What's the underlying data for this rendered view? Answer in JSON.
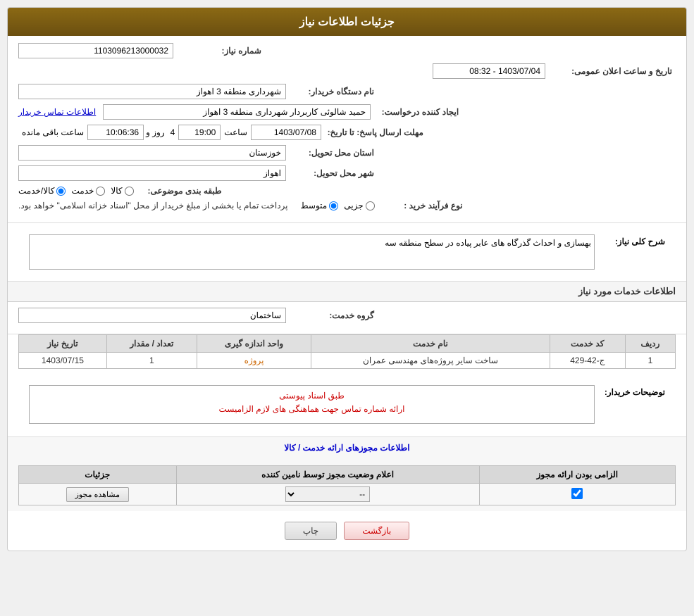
{
  "header": {
    "title": "جزئیات اطلاعات نیاز"
  },
  "fields": {
    "shomareNiaz_label": "شماره نیاز:",
    "shomareNiaz_value": "1103096213000032",
    "namDastgah_label": "نام دستگاه خریدار:",
    "namDastgah_value": "شهرداری منطقه 3 اهواز",
    "ijadKonande_label": "ایجاد کننده درخواست:",
    "ijadKonande_value": "حمید شالوئی کاربردار شهرداری منطقه 3 اهواز",
    "moshkhFile_label": "اطلاعات تماس خریدار",
    "tarikh_label": "مهلت ارسال پاسخ: تا تاریخ:",
    "tarikh_date": "1403/07/08",
    "tarikh_saat_label": "ساعت",
    "tarikh_saat_value": "19:00",
    "tarikh_roz_label": "روز و",
    "tarikh_roz_value": "4",
    "tarikh_baqi_value": "10:06:36",
    "tarikh_baqi_label": "ساعت باقی مانده",
    "ilan_label": "تاریخ و ساعت اعلان عمومی:",
    "ilan_value": "1403/07/04 - 08:32",
    "ostan_label": "استان محل تحویل:",
    "ostan_value": "خوزستان",
    "shahr_label": "شهر محل تحویل:",
    "shahr_value": "اهواز",
    "tabaqe_label": "طبقه بندی موضوعی:",
    "tabaqe_kala": "کالا",
    "tabaqe_khedmat": "خدمت",
    "tabaqe_kala_khedmat": "کالا/خدمت",
    "noeFarayand_label": "نوع فرآیند خرید :",
    "noeFarayand_jozii": "جزیی",
    "noeFarayand_motaset": "متوسط",
    "noeFarayand_desc": "پرداخت تمام یا بخشی از مبلغ خریدار از محل \"اسناد خزانه اسلامی\" خواهد بود.",
    "sharhKoli_label": "شرح کلی نیاز:",
    "sharhKoli_value": "بهسازی و احداث گذرگاه های عابر پیاده در سطح منطقه سه",
    "khadamat_title": "اطلاعات خدمات مورد نیاز",
    "gorohe_label": "گروه خدمت:",
    "gorohe_value": "ساختمان",
    "table": {
      "headers": [
        "ردیف",
        "کد خدمت",
        "نام خدمت",
        "واحد اندازه گیری",
        "تعداد / مقدار",
        "تاریخ نیاز"
      ],
      "rows": [
        {
          "radif": "1",
          "kodKhedmat": "ج-42-429",
          "namKhedmat": "ساخت سایر پروژه‌های مهندسی عمران",
          "vahed": "پروژه",
          "tedad": "1",
          "tarikh": "1403/07/15"
        }
      ]
    },
    "tozihat_label": "توضیحات خریدار:",
    "tozihat_line1": "طبق اسناد پیوستی",
    "tozihat_line2": "ارائه شماره تماس جهت هماهنگی های لازم الزامیست",
    "majozat_title": "اطلاعات مجوزهای ارائه خدمت / کالا",
    "majozat_table": {
      "headers": [
        "الزامی بودن ارائه مجوز",
        "اعلام وضعیت مجوز توسط نامین کننده",
        "جزئیات"
      ],
      "rows": [
        {
          "elzami": true,
          "eelam": "--",
          "joziyat": "مشاهده مجوز"
        }
      ]
    }
  },
  "buttons": {
    "print": "چاپ",
    "back": "بازگشت"
  }
}
